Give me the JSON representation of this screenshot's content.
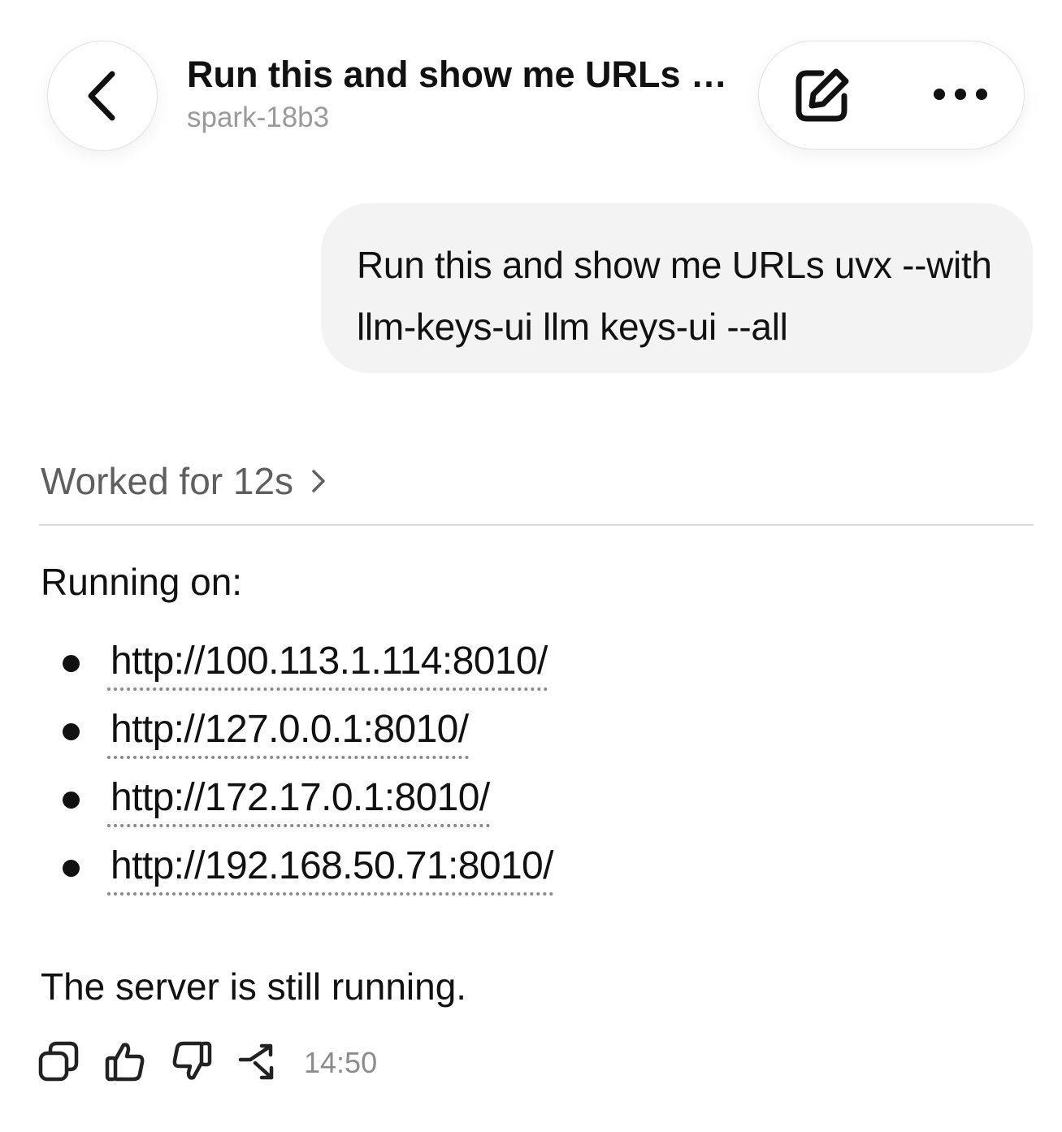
{
  "header": {
    "back_icon": "chevron-left-icon",
    "title": "Run this and show me URLs u...",
    "subtitle": "spark-18b3",
    "edit_icon": "edit-icon",
    "more_icon": "more-horizontal-icon"
  },
  "conversation": {
    "user_message": "Run this and show me URLs uvx --with llm-keys-ui llm keys-ui --all",
    "worked_label": "Worked for 12s",
    "running_on_label": "Running on:",
    "urls": [
      "http://100.113.1.114:8010/",
      "http://127.0.0.1:8010/",
      "http://172.17.0.1:8010/",
      "http://192.168.50.71:8010/"
    ],
    "status_text": "The server is still running."
  },
  "message_actions": {
    "icons": [
      "copy-icon",
      "thumbs-up-icon",
      "thumbs-down-icon",
      "shuffle-icon"
    ],
    "timestamp": "14:50"
  },
  "colors": {
    "text": "#111111",
    "muted": "#9a9a9a",
    "bubble_bg": "#f3f3f3",
    "divider": "#dcdcdc"
  }
}
